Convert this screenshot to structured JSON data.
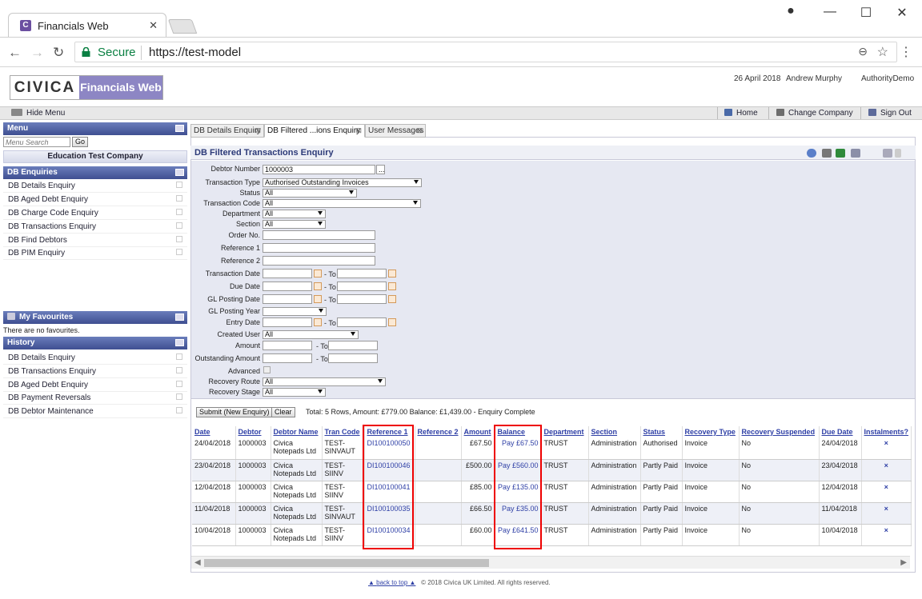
{
  "browser": {
    "tab_title": "Financials Web",
    "tab_close": "✕",
    "secure_label": "Secure",
    "url": "https://test-model"
  },
  "app": {
    "logo_left": "CIVICA",
    "logo_right": "Financials Web",
    "date": "26 April 2018",
    "user": "Andrew Murphy",
    "authority": "AuthorityDemo"
  },
  "menubar": {
    "hide_menu": "Hide Menu",
    "home": "Home",
    "change_company": "Change Company",
    "sign_out": "Sign Out"
  },
  "sidebar": {
    "menu_title": "Menu",
    "search_placeholder": "Menu Search",
    "go_label": "Go",
    "company": "Education Test Company",
    "enquiries_title": "DB Enquiries",
    "enquiries": [
      "DB Details Enquiry",
      "DB Aged Debt Enquiry",
      "DB Charge Code Enquiry",
      "DB Transactions Enquiry",
      "DB Find Debtors",
      "DB PIM Enquiry"
    ],
    "favourites_title": "My Favourites",
    "favourites_empty": "There are no favourites.",
    "history_title": "History",
    "history": [
      "DB Details Enquiry",
      "DB Transactions Enquiry",
      "DB Aged Debt Enquiry",
      "DB Payment Reversals",
      "DB Debtor Maintenance"
    ]
  },
  "tabs": [
    "DB Details Enquiry",
    "DB Filtered ...ions Enquiry",
    "User Messages"
  ],
  "panel_title": "DB Filtered Transactions Enquiry",
  "form": {
    "debtor_number_label": "Debtor Number",
    "debtor_number": "1000003",
    "lookup": "...",
    "transaction_type_label": "Transaction Type",
    "transaction_type": "Authorised Outstanding Invoices",
    "status_label": "Status",
    "status": "All",
    "transaction_code_label": "Transaction Code",
    "transaction_code": "All",
    "department_label": "Department",
    "department": "All",
    "section_label": "Section",
    "section": "All",
    "order_no_label": "Order No.",
    "reference1_label": "Reference 1",
    "reference2_label": "Reference 2",
    "transaction_date_label": "Transaction Date",
    "due_date_label": "Due Date",
    "gl_posting_date_label": "GL Posting Date",
    "gl_posting_year_label": "GL Posting Year",
    "entry_date_label": "Entry Date",
    "created_user_label": "Created User",
    "created_user": "All",
    "amount_label": "Amount",
    "outstanding_amount_label": "Outstanding Amount",
    "advanced_label": "Advanced",
    "recovery_route_label": "Recovery Route",
    "recovery_route": "All",
    "recovery_stage_label": "Recovery Stage",
    "recovery_stage": "All",
    "to_label": "- To"
  },
  "actions": {
    "submit": "Submit (New Enquiry)",
    "clear": "Clear",
    "summary": "Total: 5 Rows, Amount: £779.00 Balance: £1,439.00 - Enquiry Complete"
  },
  "table": {
    "headers": [
      "Date",
      "Debtor",
      "Debtor Name",
      "Tran Code",
      "Reference 1",
      "Reference 2",
      "Amount",
      "Balance",
      "Department",
      "Section",
      "Status",
      "Recovery Type",
      "Recovery Suspended",
      "Due Date",
      "Instalments?"
    ],
    "rows": [
      [
        "24/04/2018",
        "1000003",
        "Civica Notepads Ltd",
        "TEST-SINVAUT",
        "DI100100050",
        "",
        "£67.50",
        "Pay £67.50",
        "TRUST",
        "Administration",
        "Authorised",
        "Invoice",
        "No",
        "24/04/2018",
        "×"
      ],
      [
        "23/04/2018",
        "1000003",
        "Civica Notepads Ltd",
        "TEST-SIINV",
        "DI100100046",
        "",
        "£500.00",
        "Pay £560.00",
        "TRUST",
        "Administration",
        "Partly Paid",
        "Invoice",
        "No",
        "23/04/2018",
        "×"
      ],
      [
        "12/04/2018",
        "1000003",
        "Civica Notepads Ltd",
        "TEST-SIINV",
        "DI100100041",
        "",
        "£85.00",
        "Pay £135.00",
        "TRUST",
        "Administration",
        "Partly Paid",
        "Invoice",
        "No",
        "12/04/2018",
        "×"
      ],
      [
        "11/04/2018",
        "1000003",
        "Civica Notepads Ltd",
        "TEST-SINVAUT",
        "DI100100035",
        "",
        "£66.50",
        "Pay £35.00",
        "TRUST",
        "Administration",
        "Partly Paid",
        "Invoice",
        "No",
        "11/04/2018",
        "×"
      ],
      [
        "10/04/2018",
        "1000003",
        "Civica Notepads Ltd",
        "TEST-SIINV",
        "DI100100034",
        "",
        "£60.00",
        "Pay £641.50",
        "TRUST",
        "Administration",
        "Partly Paid",
        "Invoice",
        "No",
        "10/04/2018",
        "×"
      ]
    ]
  },
  "footer": {
    "back_to_top": "back to top",
    "copyright": "© 2018 Civica UK Limited. All rights reserved."
  },
  "colors": {
    "accent": "#2f40a6",
    "highlight_box": "#e00000",
    "logo_band": "#8d86c4"
  }
}
